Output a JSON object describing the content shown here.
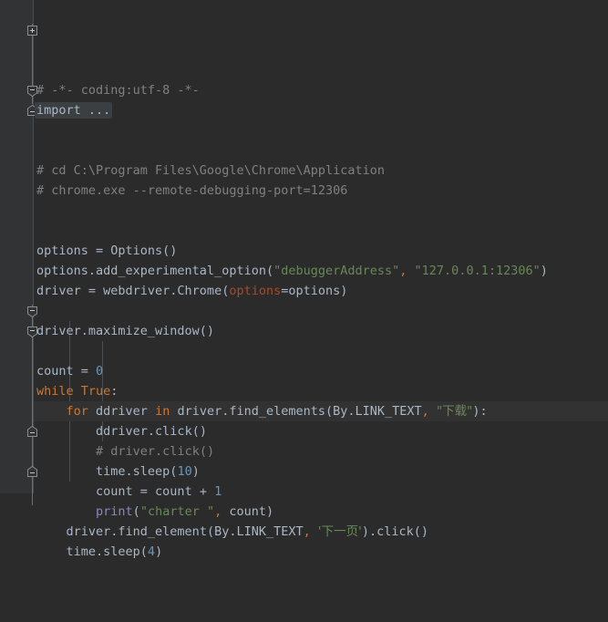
{
  "app": {
    "name": "python-code-editor",
    "language": "Python",
    "theme": "Darcula"
  },
  "colors": {
    "background": "#2b2b2b",
    "gutter": "#313335",
    "current_line": "#323232",
    "default_text": "#a9b7c6",
    "comment": "#808080",
    "keyword": "#cc7832",
    "string": "#6a8759",
    "number": "#6897bb",
    "builtin": "#8888c6",
    "kwarg": "#aa4926",
    "fold_rail": "#6e7072",
    "folded_region": "#3c3f41",
    "indent_guide": "#4b4e50"
  },
  "editor": {
    "current_line_index": 15,
    "lines": [
      {
        "index": 0,
        "indent": 0,
        "tokens": [
          {
            "c": "comment",
            "t": "# -*- coding:utf-8 -*-"
          }
        ]
      },
      {
        "index": 1,
        "indent": 0,
        "folded": true,
        "tokens": [
          {
            "c": "folded",
            "t": "import ..."
          }
        ]
      },
      {
        "index": 2,
        "indent": 0,
        "tokens": []
      },
      {
        "index": 3,
        "indent": 0,
        "tokens": []
      },
      {
        "index": 4,
        "indent": 0,
        "tokens": [
          {
            "c": "comment",
            "t": "# cd C:\\Program Files\\Google\\Chrome\\Application"
          }
        ]
      },
      {
        "index": 5,
        "indent": 0,
        "tokens": [
          {
            "c": "comment",
            "t": "# chrome.exe --remote-debugging-port=12306"
          }
        ]
      },
      {
        "index": 6,
        "indent": 0,
        "tokens": []
      },
      {
        "index": 7,
        "indent": 0,
        "tokens": []
      },
      {
        "index": 8,
        "indent": 0,
        "tokens": [
          {
            "c": "default",
            "t": "options = Options()"
          }
        ]
      },
      {
        "index": 9,
        "indent": 0,
        "tokens": [
          {
            "c": "default",
            "t": "options.add_experimental_option("
          },
          {
            "c": "string",
            "t": "\"debuggerAddress\""
          },
          {
            "c": "comma",
            "t": ","
          },
          {
            "c": "default",
            "t": " "
          },
          {
            "c": "string",
            "t": "\"127.0.0.1:12306\""
          },
          {
            "c": "default",
            "t": ")"
          }
        ]
      },
      {
        "index": 10,
        "indent": 0,
        "tokens": [
          {
            "c": "default",
            "t": "driver = webdriver.Chrome("
          },
          {
            "c": "kwarg",
            "t": "options"
          },
          {
            "c": "default",
            "t": "=options)"
          }
        ]
      },
      {
        "index": 11,
        "indent": 0,
        "tokens": []
      },
      {
        "index": 12,
        "indent": 0,
        "tokens": [
          {
            "c": "default",
            "t": "driver.maximize_window()"
          }
        ]
      },
      {
        "index": 13,
        "indent": 0,
        "tokens": []
      },
      {
        "index": 14,
        "indent": 0,
        "tokens": [
          {
            "c": "default",
            "t": "count = "
          },
          {
            "c": "number",
            "t": "0"
          }
        ]
      },
      {
        "index": 15,
        "indent": 0,
        "tokens": [
          {
            "c": "keyword",
            "t": "while True"
          },
          {
            "c": "default",
            "t": ":"
          }
        ]
      },
      {
        "index": 16,
        "indent": 1,
        "current": true,
        "tokens": [
          {
            "c": "keyword",
            "t": "for"
          },
          {
            "c": "default",
            "t": " ddriver "
          },
          {
            "c": "keyword",
            "t": "in"
          },
          {
            "c": "default",
            "t": " driver.find_elements(By.LINK_TEXT"
          },
          {
            "c": "comma",
            "t": ","
          },
          {
            "c": "default",
            "t": " "
          },
          {
            "c": "string",
            "t": "\"下载\""
          },
          {
            "c": "default",
            "t": "):"
          }
        ]
      },
      {
        "index": 17,
        "indent": 2,
        "tokens": [
          {
            "c": "default",
            "t": "ddriver.click()"
          }
        ]
      },
      {
        "index": 18,
        "indent": 2,
        "tokens": [
          {
            "c": "comment",
            "t": "# driver.click()"
          }
        ]
      },
      {
        "index": 19,
        "indent": 2,
        "tokens": [
          {
            "c": "default",
            "t": "time.sleep("
          },
          {
            "c": "number",
            "t": "10"
          },
          {
            "c": "default",
            "t": ")"
          }
        ]
      },
      {
        "index": 20,
        "indent": 2,
        "tokens": [
          {
            "c": "default",
            "t": "count = count + "
          },
          {
            "c": "number",
            "t": "1"
          }
        ]
      },
      {
        "index": 21,
        "indent": 2,
        "tokens": [
          {
            "c": "builtin",
            "t": "print"
          },
          {
            "c": "default",
            "t": "("
          },
          {
            "c": "string",
            "t": "\"charter \""
          },
          {
            "c": "comma",
            "t": ","
          },
          {
            "c": "default",
            "t": " count)"
          }
        ]
      },
      {
        "index": 22,
        "indent": 1,
        "tokens": [
          {
            "c": "default",
            "t": "driver.find_element(By.LINK_TEXT"
          },
          {
            "c": "comma",
            "t": ","
          },
          {
            "c": "default",
            "t": " "
          },
          {
            "c": "string",
            "t": "'下一页'"
          },
          {
            "c": "default",
            "t": ").click()"
          }
        ]
      },
      {
        "index": 23,
        "indent": 1,
        "tokens": [
          {
            "c": "default",
            "t": "time.sleep("
          },
          {
            "c": "number",
            "t": "4"
          },
          {
            "c": "default",
            "t": ")"
          }
        ]
      },
      {
        "index": 24,
        "indent": 0,
        "tokens": []
      }
    ],
    "fold_markers": [
      {
        "name": "fold-marker-import",
        "line": 1,
        "state": "collapsed",
        "glyph": "plus-box-icon"
      },
      {
        "name": "fold-marker-comment-block",
        "line": 4,
        "state": "expanded",
        "glyph": "minus-box-down-icon"
      },
      {
        "name": "fold-marker-comment-end",
        "line": 5,
        "state": "expanded-end",
        "glyph": "minus-box-up-icon"
      },
      {
        "name": "fold-marker-while",
        "line": 15,
        "state": "expanded",
        "glyph": "minus-box-down-icon"
      },
      {
        "name": "fold-marker-for",
        "line": 16,
        "state": "expanded",
        "glyph": "minus-box-down-icon"
      },
      {
        "name": "fold-marker-for-end",
        "line": 21,
        "state": "expanded-end",
        "glyph": "minus-box-up-icon"
      },
      {
        "name": "fold-marker-while-end",
        "line": 23,
        "state": "expanded-end",
        "glyph": "minus-box-up-icon"
      }
    ],
    "fold_rails": [
      {
        "name": "fold-rail-top",
        "from_line": 1,
        "to_line": 5
      },
      {
        "name": "fold-rail-bottom",
        "from_line": 15,
        "to_line": 25
      }
    ],
    "indent_guides": [
      {
        "name": "indent-guide-level-1",
        "from_line": 16,
        "to_line": 24,
        "level": 1
      },
      {
        "name": "indent-guide-level-2",
        "from_line": 17,
        "to_line": 22,
        "level": 2
      }
    ]
  }
}
